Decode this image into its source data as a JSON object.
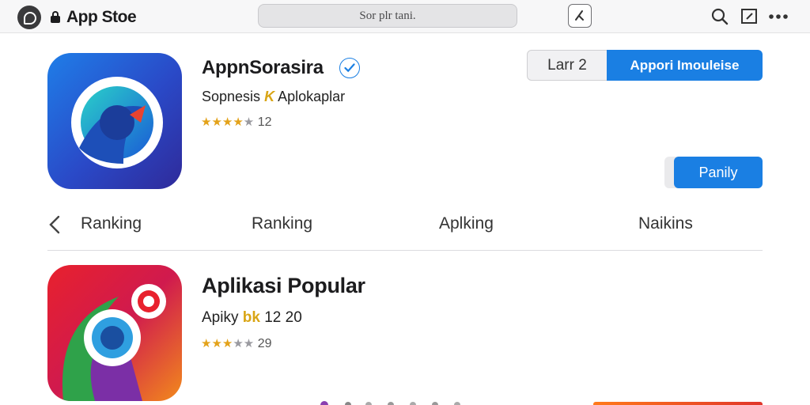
{
  "topbar": {
    "brand": "App Stoe",
    "search_placeholder": "Sor plr tani.",
    "icons": [
      "apple-logo-icon",
      "lock-icon",
      "edit-icon",
      "search-icon",
      "window-icon",
      "more-icon"
    ]
  },
  "featured_app": {
    "title": "AppnSorasira",
    "developer": "Sopnesis",
    "developer_mark": "K",
    "category": "Aplokaplar",
    "rating_stars": 4,
    "rating_count": "12",
    "secondary_button": "Larr 2",
    "primary_button": "Appori Imouleise",
    "side_button": "Panily",
    "accent_color": "#1a7fe3"
  },
  "tabs": [
    "Ranking",
    "Ranking",
    "Aplking",
    "Naikins"
  ],
  "popular_app": {
    "title": "Aplikasi Popular",
    "developer": "Apiky",
    "developer_mark": "bk",
    "meta": "12 20",
    "rating_stars": 3,
    "rating_count": "29"
  }
}
